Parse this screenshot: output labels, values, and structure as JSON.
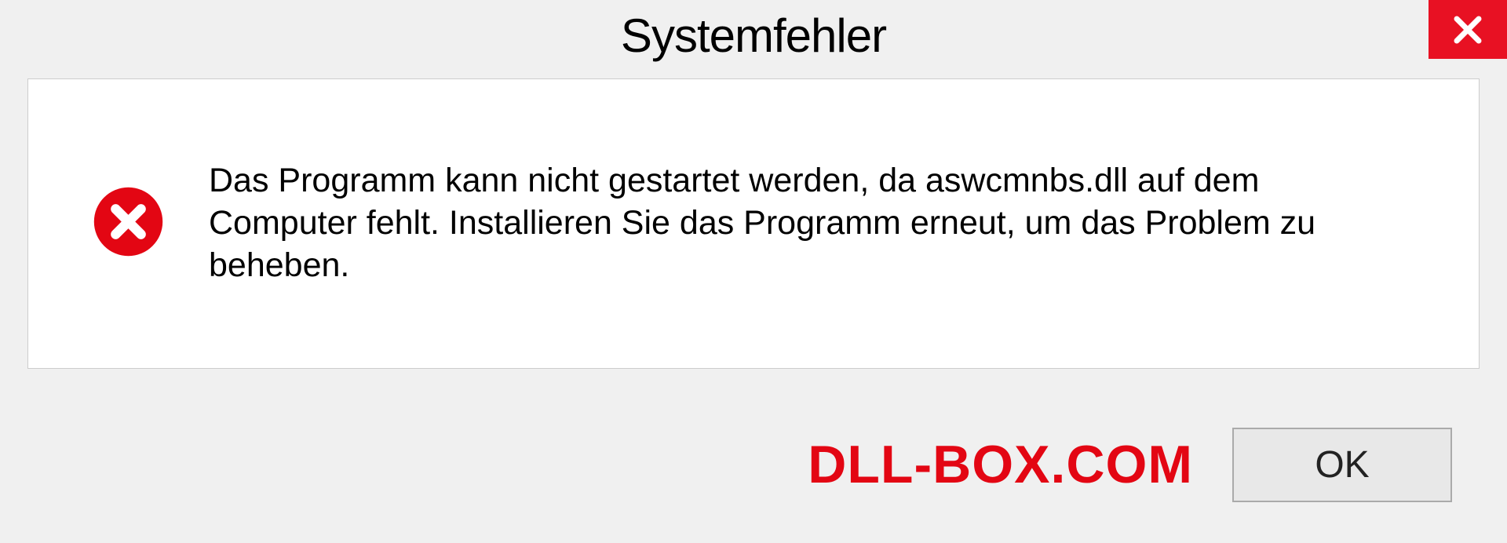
{
  "dialog": {
    "title": "Systemfehler",
    "message": "Das Programm kann nicht gestartet werden, da aswcmnbs.dll auf dem Computer fehlt. Installieren Sie das Programm erneut, um das Problem zu beheben.",
    "ok_label": "OK"
  },
  "watermark": "DLL-BOX.COM",
  "colors": {
    "close_button": "#e81123",
    "error_icon": "#e30613",
    "watermark": "#e30613"
  }
}
